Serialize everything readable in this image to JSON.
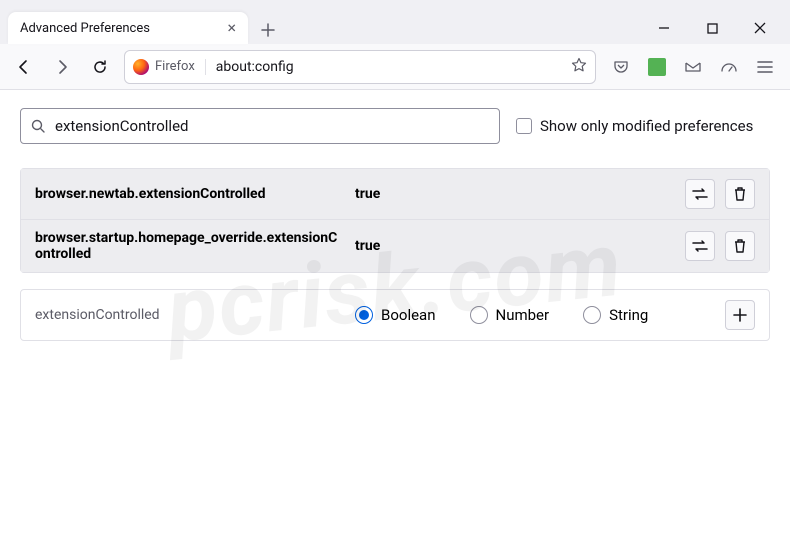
{
  "window": {
    "tab_title": "Advanced Preferences"
  },
  "identity": {
    "label": "Firefox"
  },
  "url": "about:config",
  "search": {
    "value": "extensionControlled",
    "placeholder": ""
  },
  "filter": {
    "show_modified_label": "Show only modified preferences",
    "checked": false
  },
  "prefs": [
    {
      "name": "browser.newtab.extensionControlled",
      "value": "true",
      "modified": true
    },
    {
      "name": "browser.startup.homepage_override.extensionControlled",
      "value": "true",
      "modified": true
    }
  ],
  "new_pref": {
    "name": "extensionControlled",
    "options": [
      "Boolean",
      "Number",
      "String"
    ],
    "selected": "Boolean"
  },
  "watermark": "pcrisk.com"
}
